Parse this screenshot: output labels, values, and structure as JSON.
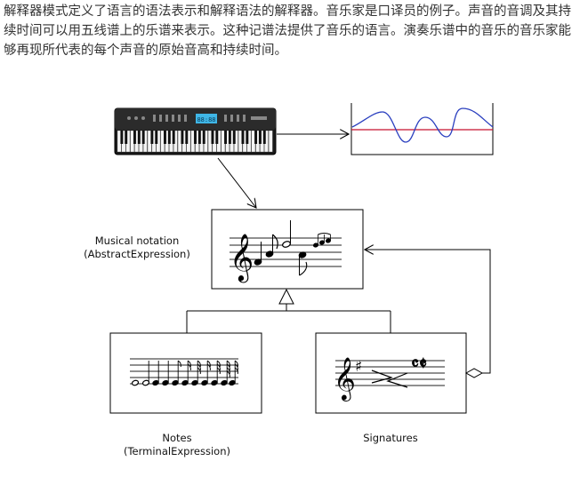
{
  "intro": "解释器模式定义了语言的语法表示和解释语法的解释器。音乐家是口译员的例子。声音的音调及其持续时间可以用五线谱上的乐谱来表示。这种记谱法提供了音乐的语言。演奏乐谱中的音乐的音乐家能够再现所代表的每个声音的原始音高和持续时间。",
  "labels": {
    "abstract_line1": "Musical notation",
    "abstract_line2": "(AbstractExpression)",
    "notes_line1": "Notes",
    "notes_line2": "(TerminalExpression)",
    "signatures": "Signatures"
  },
  "keyboard_display": "88:88",
  "time_signature": "𝄴𝄵",
  "colors": {
    "waveform": "#2a3fbf",
    "baseline": "#c8102e",
    "keyboard_display": "#3fb6e6"
  },
  "icons": [
    "keyboard-icon",
    "waveform-icon",
    "treble-clef-icon",
    "sharp-icon",
    "crescendo-icon"
  ]
}
